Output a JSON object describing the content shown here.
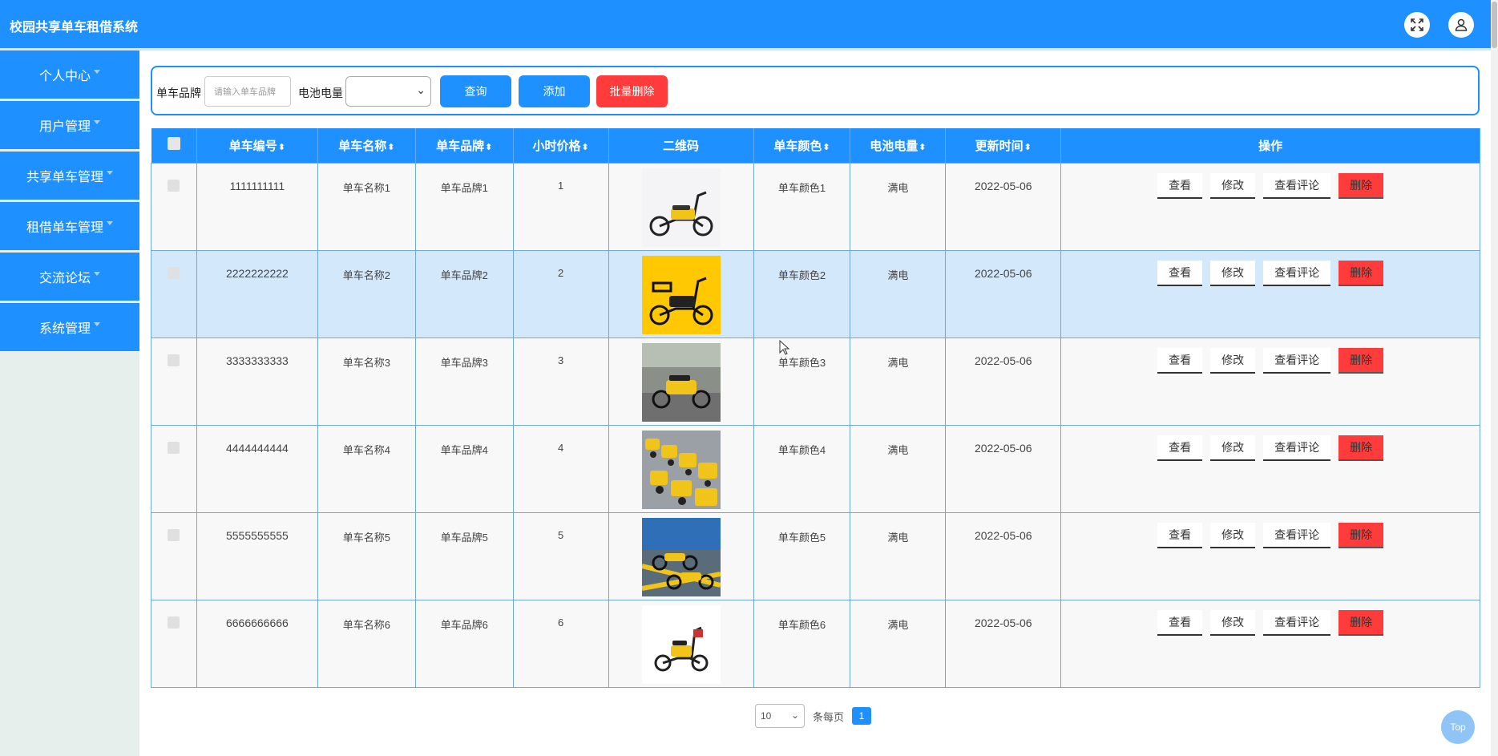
{
  "app": {
    "title": "校园共享单车租借系统"
  },
  "header": {
    "fullscreen_icon": "expand-icon",
    "user_icon": "user-icon"
  },
  "sidebar": {
    "items": [
      {
        "label": "个人中心"
      },
      {
        "label": "用户管理"
      },
      {
        "label": "共享单车管理"
      },
      {
        "label": "租借单车管理"
      },
      {
        "label": "交流论坛"
      },
      {
        "label": "系统管理"
      }
    ]
  },
  "search": {
    "brand_label": "单车品牌",
    "brand_placeholder": "请输入单车品牌",
    "battery_label": "电池电量",
    "battery_value": "",
    "query_label": "查询",
    "add_label": "添加",
    "batch_delete_label": "批量删除"
  },
  "table": {
    "columns": [
      "单车编号",
      "单车名称",
      "单车品牌",
      "小时价格",
      "二维码",
      "单车颜色",
      "电池电量",
      "更新时间",
      "操作"
    ],
    "sort_glyph": "⬍",
    "actions": {
      "view": "查看",
      "edit": "修改",
      "comments": "查看评论",
      "delete": "删除"
    },
    "rows": [
      {
        "id": "1111111111",
        "name": "单车名称1",
        "brand": "单车品牌1",
        "price": "1",
        "color": "单车颜色1",
        "battery": "满电",
        "updated": "2022-05-06",
        "image": "yellow scooter on white"
      },
      {
        "id": "2222222222",
        "name": "单车名称2",
        "brand": "单车品牌2",
        "price": "2",
        "color": "单车颜色2",
        "battery": "满电",
        "updated": "2022-05-06",
        "image": "yellow scooter on yellow"
      },
      {
        "id": "3333333333",
        "name": "单车名称3",
        "brand": "单车品牌3",
        "price": "3",
        "color": "单车颜色3",
        "battery": "满电",
        "updated": "2022-05-06",
        "image": "scooter on street"
      },
      {
        "id": "4444444444",
        "name": "单车名称4",
        "brand": "单车品牌4",
        "price": "4",
        "color": "单车颜色4",
        "battery": "满电",
        "updated": "2022-05-06",
        "image": "row of scooters"
      },
      {
        "id": "5555555555",
        "name": "单车名称5",
        "brand": "单车品牌5",
        "price": "5",
        "color": "单车颜色5",
        "battery": "满电",
        "updated": "2022-05-06",
        "image": "scooters in parking"
      },
      {
        "id": "6666666666",
        "name": "单车名称6",
        "brand": "单车品牌6",
        "price": "6",
        "color": "单车颜色6",
        "battery": "满电",
        "updated": "2022-05-06",
        "image": "scooter side view"
      }
    ],
    "highlighted_row": 1
  },
  "pager": {
    "page_size": "10",
    "per_page_label": "条每页",
    "current_page": "1"
  },
  "top_button": {
    "label": "Top"
  },
  "colors": {
    "primary": "#1e90ff",
    "danger": "#ff3b3b",
    "sidebar_bg": "#e6efeb",
    "highlight": "#d4e8fc"
  }
}
